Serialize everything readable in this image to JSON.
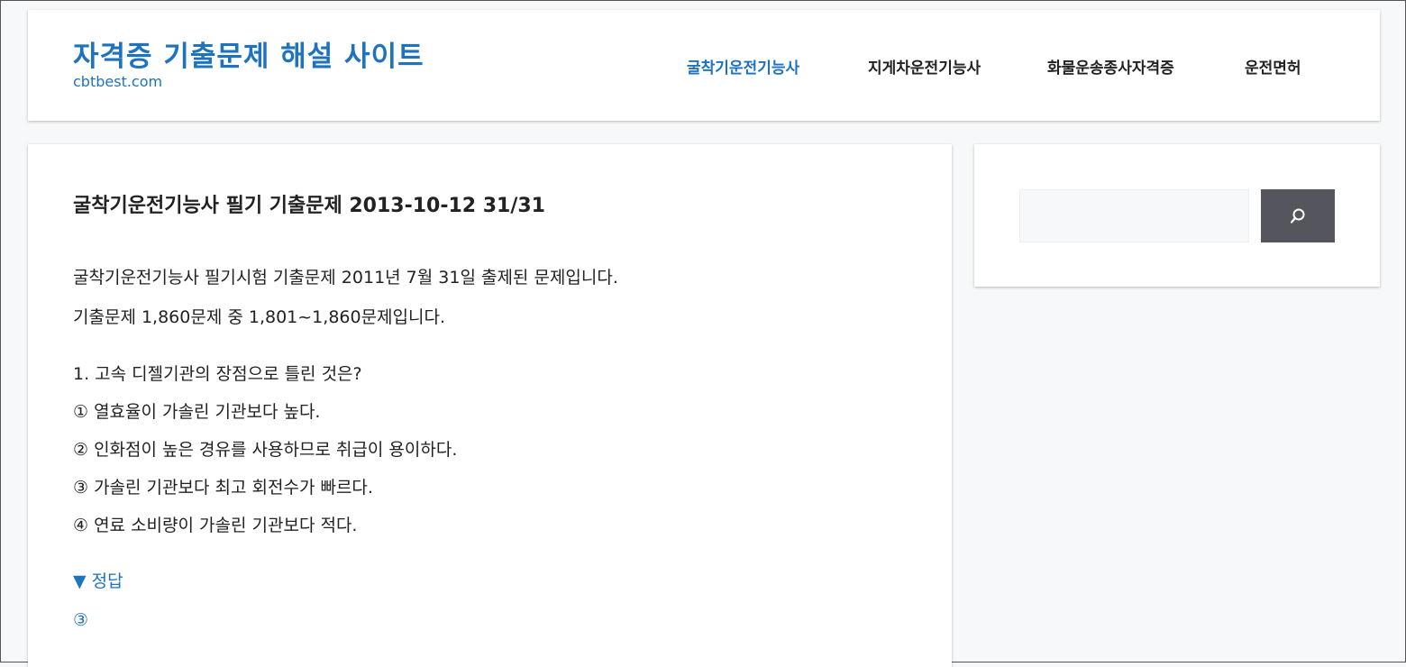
{
  "site": {
    "title": "자격증 기출문제 해설 사이트",
    "description": "cbtbest.com"
  },
  "nav": [
    {
      "label": "굴착기운전기능사",
      "active": true
    },
    {
      "label": "지게차운전기능사",
      "active": false
    },
    {
      "label": "화물운송종사자격증",
      "active": false
    },
    {
      "label": "운전면허",
      "active": false
    }
  ],
  "post": {
    "title": "굴착기운전기능사 필기 기출문제 2013-10-12 31/31",
    "intro_line1": "굴착기운전기능사 필기시험 기출문제 2011년 7월 31일 출제된 문제입니다.",
    "intro_line2": "기출문제 1,860문제 중 1,801~1,860문제입니다.",
    "question": "1. 고속 디젤기관의 장점으로 틀린 것은?",
    "options": [
      "① 열효율이 가솔린 기관보다 높다.",
      "② 인화점이 높은 경유를 사용하므로 취급이 용이하다.",
      "③ 가솔린 기관보다 최고 회전수가 빠르다.",
      "④ 연료 소비량이 가솔린 기관보다 적다."
    ],
    "answer_toggle": "▼ 정답",
    "answer": "③"
  },
  "sidebar": {
    "search_value": "",
    "search_icon": "search-icon"
  },
  "colors": {
    "accent": "#1e73be",
    "search_button": "#55555e",
    "background": "#f7f8f9"
  }
}
